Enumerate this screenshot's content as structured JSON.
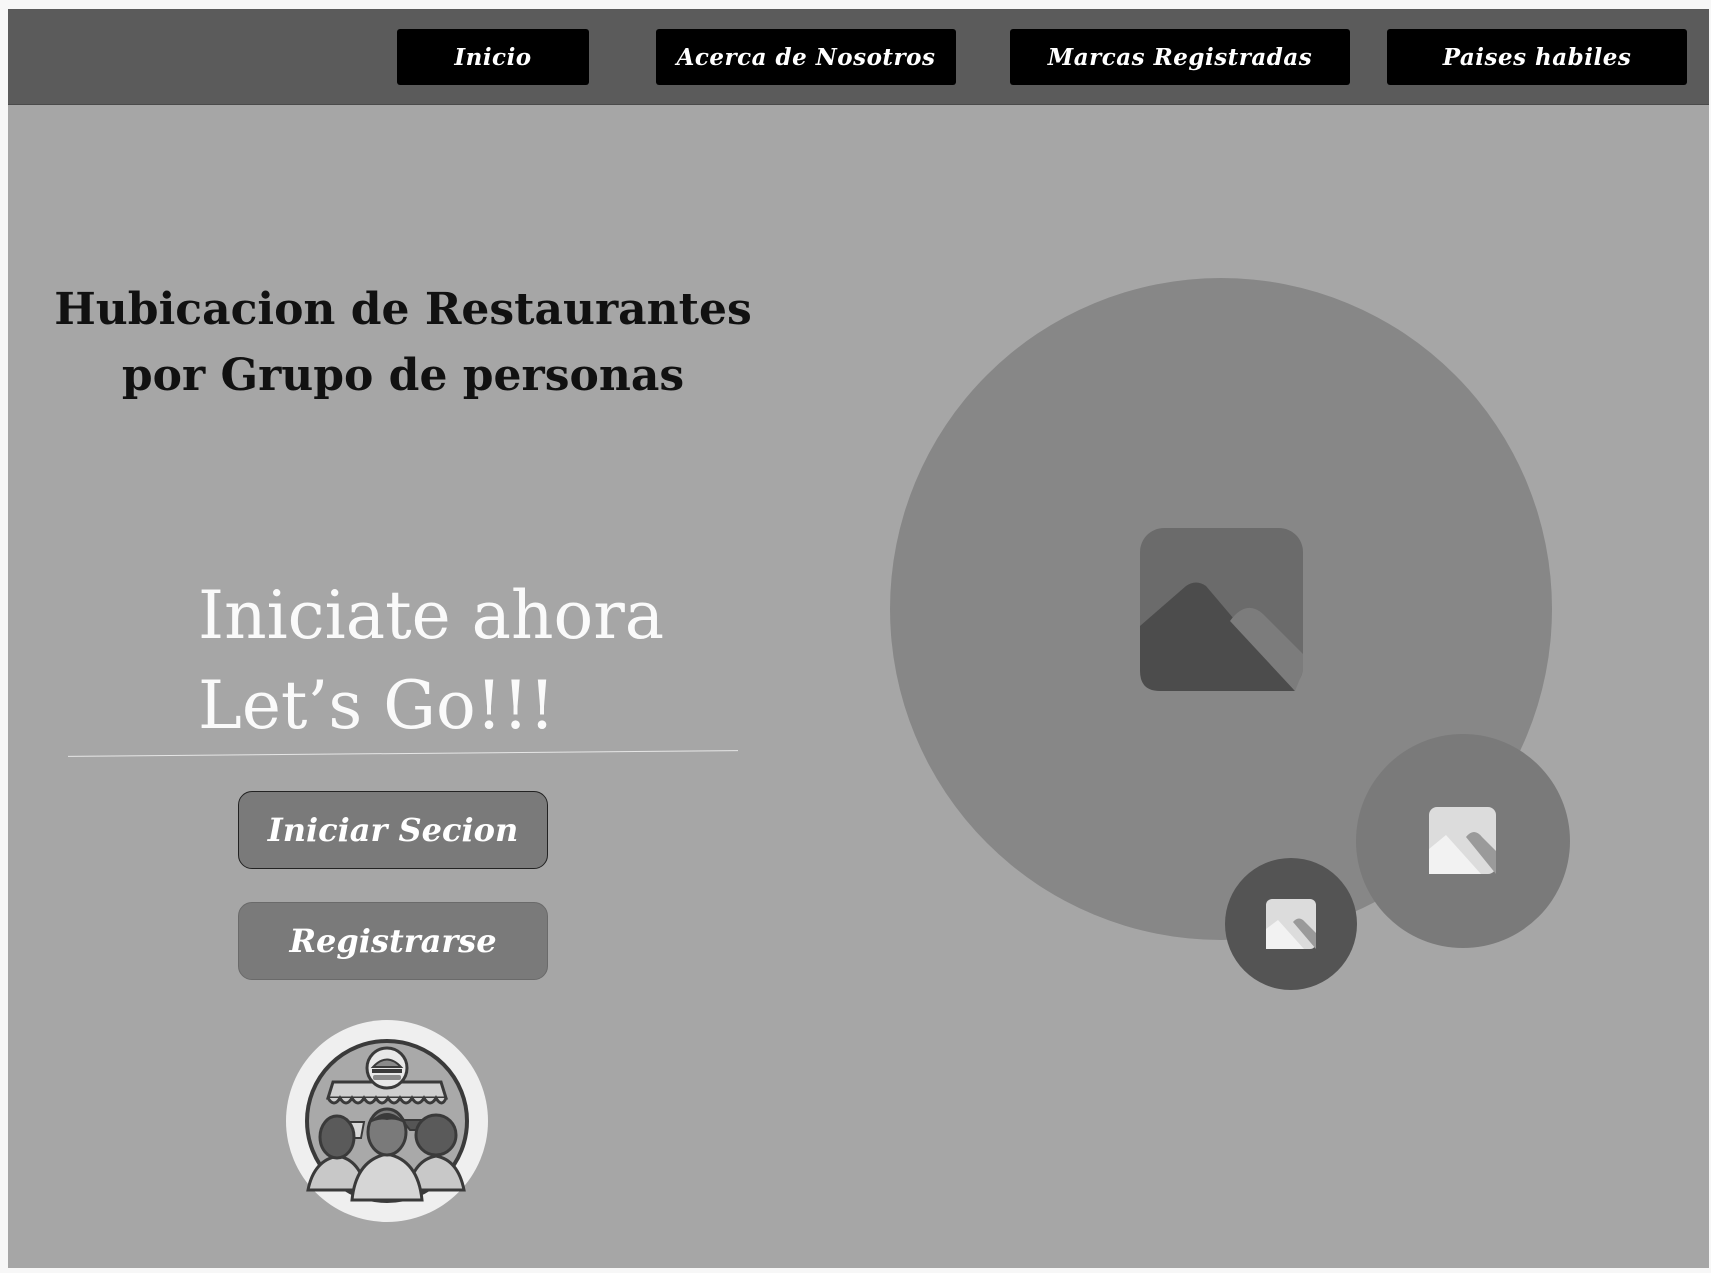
{
  "nav": {
    "items": [
      {
        "label": "Inicio"
      },
      {
        "label": "Acerca de Nosotros"
      },
      {
        "label": "Marcas Registradas"
      },
      {
        "label": "Paises habiles"
      }
    ]
  },
  "hero": {
    "title_line1": "Hubicacion de Restaurantes",
    "title_line2": "por Grupo de personas",
    "cta_line1": "Iniciate ahora",
    "cta_line2": "Let’s Go!!!"
  },
  "actions": {
    "login_label": "Iniciar Secion",
    "register_label": "Registrarse"
  },
  "icons": {
    "logo": "restaurant-group-logo-icon",
    "placeholder": "image-placeholder-icon"
  },
  "colors": {
    "background": "#a6a6a6",
    "navbar": "#5b5b5b",
    "nav_button": "#000000",
    "action_button": "#7a7a7a"
  }
}
